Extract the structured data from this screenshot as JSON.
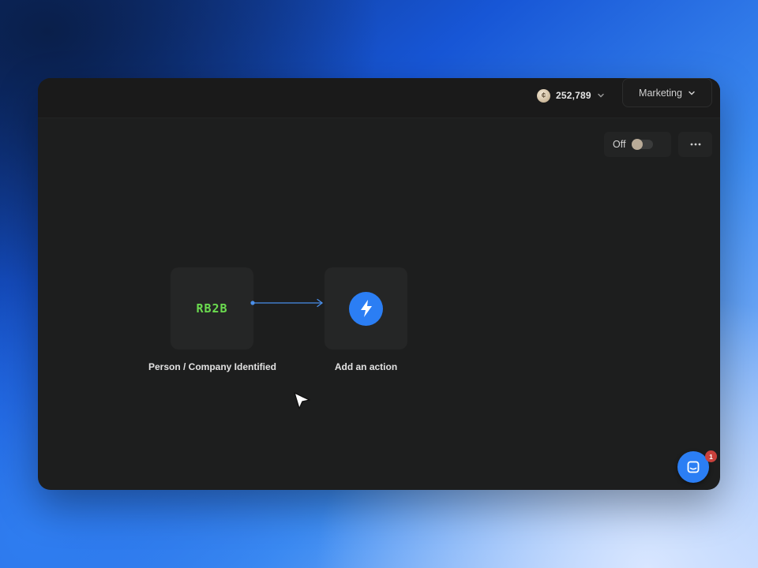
{
  "header": {
    "credits": {
      "value": "252,789",
      "coin_icon": "coin-icon"
    },
    "workspace": {
      "label": "Marketing"
    }
  },
  "controls": {
    "toggle_label": "Off",
    "toggle_state": "off",
    "more_icon": "more-horizontal-icon"
  },
  "workflow": {
    "trigger": {
      "logo": "RB2B",
      "label": "Person / Company Identified"
    },
    "action": {
      "icon": "lightning-bolt-icon",
      "label": "Add an action"
    }
  },
  "chat": {
    "badge": "1",
    "icon": "chat-icon"
  },
  "colors": {
    "accent": "#2b7ef4",
    "logo_green": "#6bdc4f",
    "badge_red": "#c9413c",
    "panel_bg": "#1d1e1e"
  }
}
